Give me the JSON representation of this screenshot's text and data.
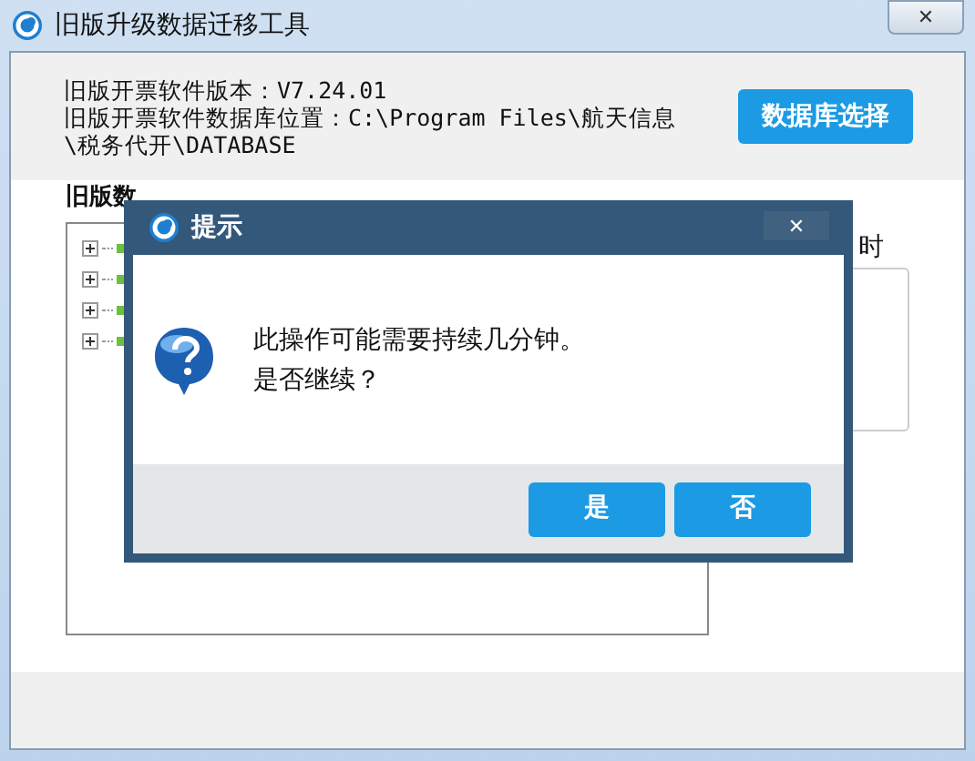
{
  "window": {
    "title": "旧版升级数据迁移工具",
    "close": "✕"
  },
  "info": {
    "version": "旧版开票软件版本：V7.24.01",
    "location": "旧版开票软件数据库位置：C:\\Program Files\\航天信息\\税务代开\\DATABASE",
    "button": "数据库选择"
  },
  "old_tables": {
    "title": "旧版数",
    "items": [
      {
        "expanded": false
      },
      {
        "expanded": false
      },
      {
        "expanded": false
      },
      {
        "expanded": false
      }
    ]
  },
  "side_label": "时",
  "dialog": {
    "title": "提示",
    "close": "✕",
    "message": "此操作可能需要持续几分钟。",
    "question": "是否继续？",
    "buttons": [
      "是",
      "否"
    ]
  }
}
